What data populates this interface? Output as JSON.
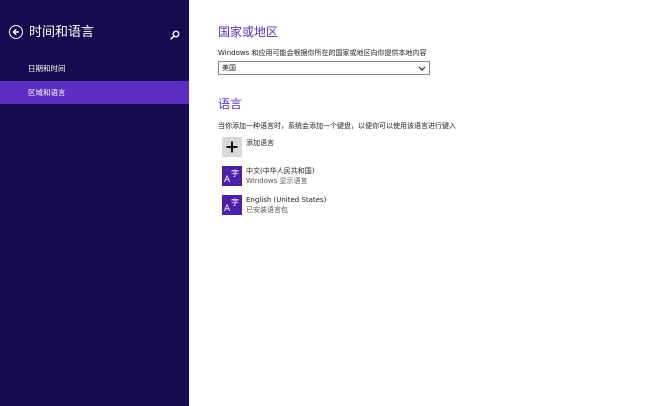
{
  "sidebar": {
    "title": "时间和语言",
    "items": [
      {
        "label": "日期和时间"
      },
      {
        "label": "区域和语言"
      }
    ]
  },
  "region": {
    "title": "国家或地区",
    "description": "Windows 和应用可能会根据你所在的国家或地区向你提供本地内容",
    "selected": "美国"
  },
  "language": {
    "title": "语言",
    "description": "当你添加一种语言时，系统会添加一个键盘，以便你可以使用该语言进行键入",
    "add_label": "添加语言",
    "items": [
      {
        "name": "中文(中华人民共和国)",
        "status": "Windows 显示语言"
      },
      {
        "name": "English (United States)",
        "status": "已安装语言包"
      }
    ]
  },
  "colors": {
    "sidebar_bg": "#180a4f",
    "sidebar_active": "#5c2dc1",
    "accent": "#5b2dbf",
    "lang_tile": "#4b1fa8"
  },
  "icons": {
    "back": "back-arrow-icon",
    "search": "search-icon",
    "add": "plus-icon",
    "language": "language-a-zi-icon",
    "dropdown": "chevron-down-icon"
  }
}
